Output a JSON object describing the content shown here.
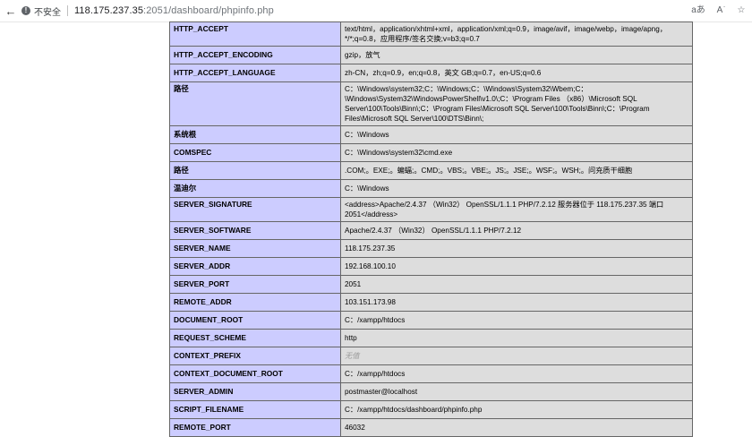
{
  "browser": {
    "insecure_label": "不安全",
    "url_host": "118.175.237.35",
    "url_rest": ":2051/dashboard/phpinfo.php",
    "icons": [
      "back-icon",
      "warning-icon",
      "translate-icon",
      "read-aloud-icon",
      "favorites-icon"
    ],
    "right_labels": [
      "aあ",
      "A͘",
      "☆"
    ]
  },
  "rows": [
    {
      "key": "HTTP_ACCEPT",
      "value": "text/html，application/xhtml+xml，application/xml;q=0.9，image/avif，image/webp，image/apng，*/*;q=0.8，应用程序/签名交换;v=b3;q=0.7"
    },
    {
      "key": "HTTP_ACCEPT_ENCODING",
      "value": "gzip，放气"
    },
    {
      "key": "HTTP_ACCEPT_LANGUAGE",
      "value": "zh-CN，zh;q=0.9，en;q=0.8，英文 GB;q=0.7，en-US;q=0.6"
    },
    {
      "key": "路径",
      "value": "C：\\Windows\\system32;C：\\Windows;C：\\Windows\\System32\\Wbem;C：\\Windows\\System32\\WindowsPowerShell\\v1.0\\;C：\\Program Files （x86）\\Microsoft SQL Server\\100\\Tools\\Binn\\;C：\\Program Files\\Microsoft SQL Server\\100\\Tools\\Binn\\;C：\\Program Files\\Microsoft SQL Server\\100\\DTS\\Binn\\;"
    },
    {
      "key": "系统根",
      "value": "C：\\Windows"
    },
    {
      "key": "COMSPEC",
      "value": "C：\\Windows\\system32\\cmd.exe"
    },
    {
      "key": "路径",
      "value": ".COM;。EXE;。蝙蝠;。CMD;。VBS;。VBE;。JS;。JSE;。WSF;。WSH;。问充质干细胞"
    },
    {
      "key": "温迪尔",
      "value": "C：\\Windows"
    },
    {
      "key": "SERVER_SIGNATURE",
      "value": "<address>Apache/2.4.37 （Win32） OpenSSL/1.1.1 PHP/7.2.12 服务器位于 118.175.237.35 端口 2051</address>"
    },
    {
      "key": "SERVER_SOFTWARE",
      "value": "Apache/2.4.37 （Win32） OpenSSL/1.1.1 PHP/7.2.12"
    },
    {
      "key": "SERVER_NAME",
      "value": "118.175.237.35"
    },
    {
      "key": "SERVER_ADDR",
      "value": "192.168.100.10"
    },
    {
      "key": "SERVER_PORT",
      "value": "2051"
    },
    {
      "key": "REMOTE_ADDR",
      "value": "103.151.173.98"
    },
    {
      "key": "DOCUMENT_ROOT",
      "value": "C：/xampp/htdocs"
    },
    {
      "key": "REQUEST_SCHEME",
      "value": "http"
    },
    {
      "key": "CONTEXT_PREFIX",
      "value": "无值"
    },
    {
      "key": "CONTEXT_DOCUMENT_ROOT",
      "value": "C：/xampp/htdocs"
    },
    {
      "key": "SERVER_ADMIN",
      "value": "postmaster@localhost"
    },
    {
      "key": "SCRIPT_FILENAME",
      "value": "C：/xampp/htdocs/dashboard/phpinfo.php"
    },
    {
      "key": "REMOTE_PORT",
      "value": "46032"
    }
  ]
}
